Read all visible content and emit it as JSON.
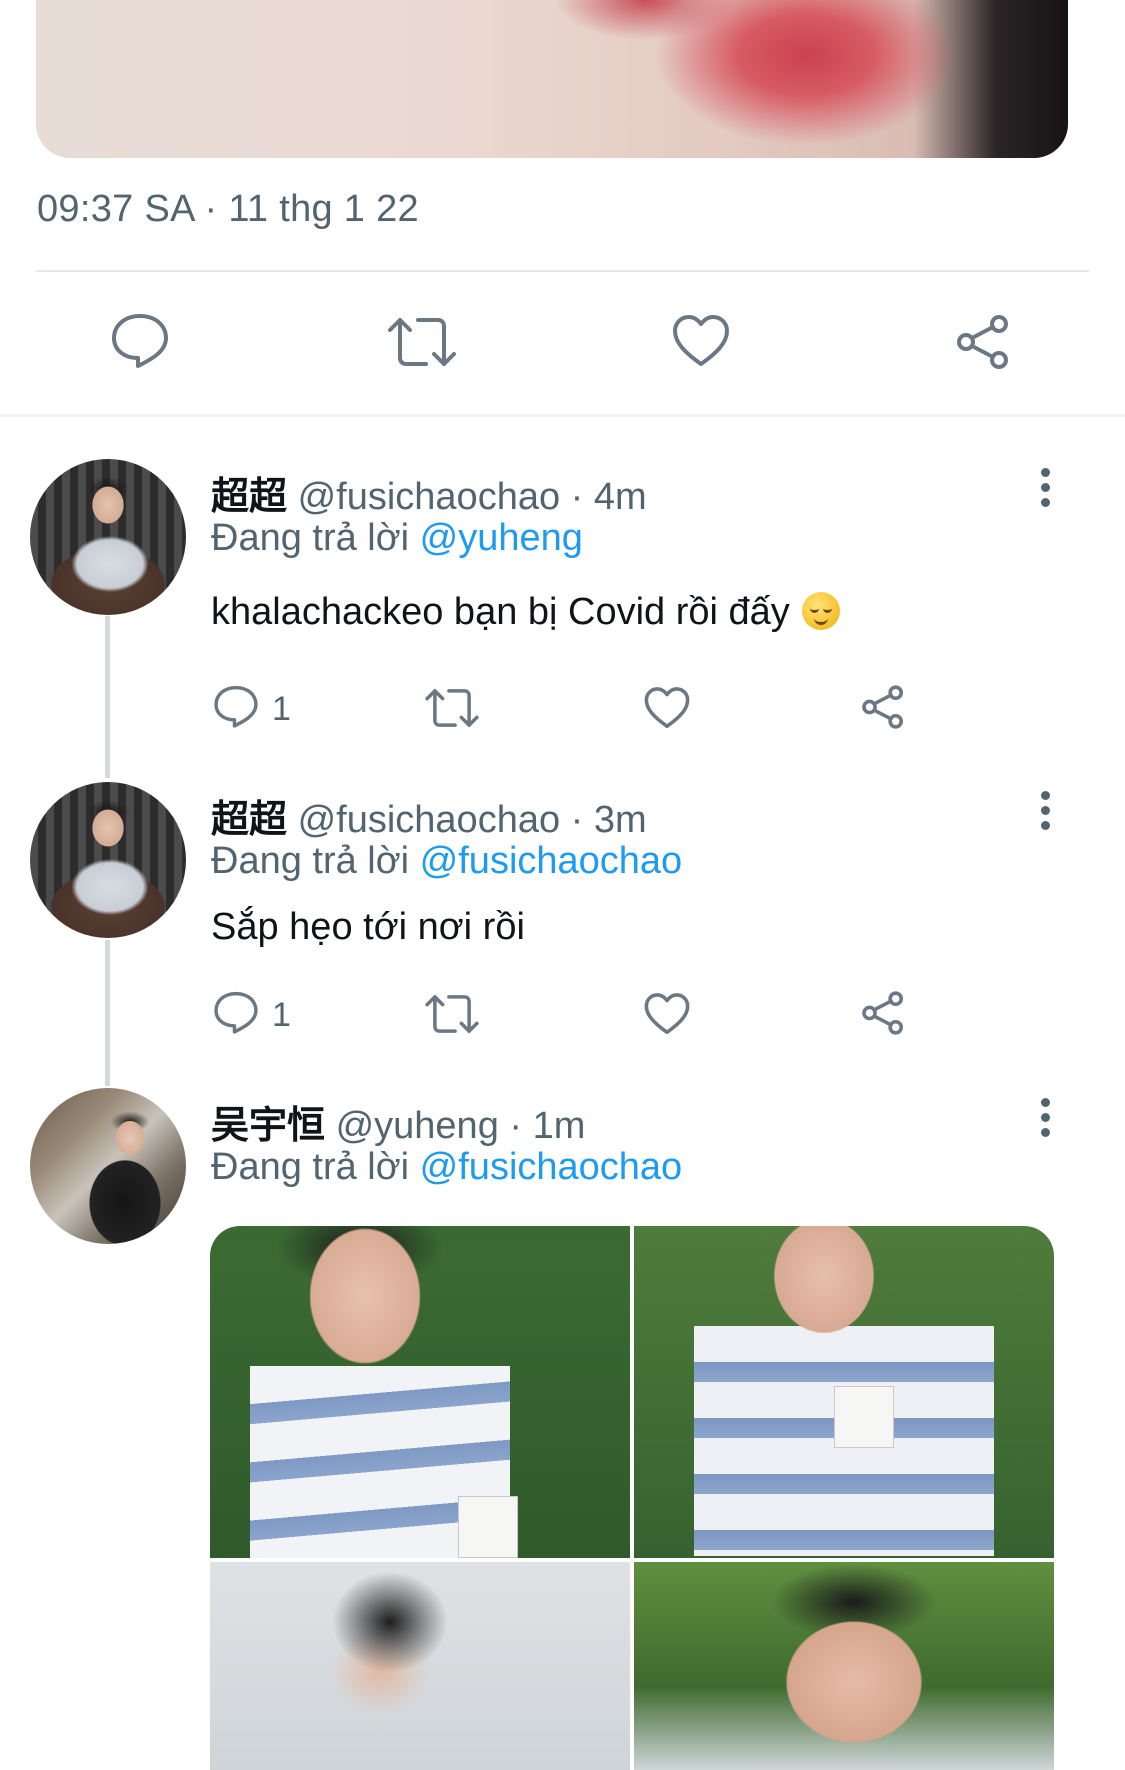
{
  "main_tweet": {
    "timestamp": "09:37 SA · 11 thg 1 22",
    "actions": [
      {
        "icon": "reply-icon"
      },
      {
        "icon": "retweet-icon"
      },
      {
        "icon": "like-icon"
      },
      {
        "icon": "share-icon"
      }
    ]
  },
  "replies": [
    {
      "name": "超超",
      "handle": "@fusichaochao",
      "time": "· 4m",
      "replying_label": "Đang trả lời",
      "replying_to": "@yuheng",
      "text": "khalachackeo bạn bị Covid rồi đấy",
      "emoji": "relieved-face",
      "reply_count": "1"
    },
    {
      "name": "超超",
      "handle": "@fusichaochao",
      "time": "· 3m",
      "replying_label": "Đang trả lời",
      "replying_to": "@fusichaochao",
      "text": "Sắp hẹo tới nơi rồi",
      "reply_count": "1"
    },
    {
      "name": "吴宇恒",
      "handle": "@yuheng",
      "time": "· 1m",
      "replying_label": "Đang trả lời",
      "replying_to": "@fusichaochao",
      "media": "photo-grid-4"
    }
  ],
  "colors": {
    "link": "#1d9bf0",
    "secondary_text": "#536471",
    "primary_text": "#0f1419",
    "icon": "#6b7884"
  }
}
